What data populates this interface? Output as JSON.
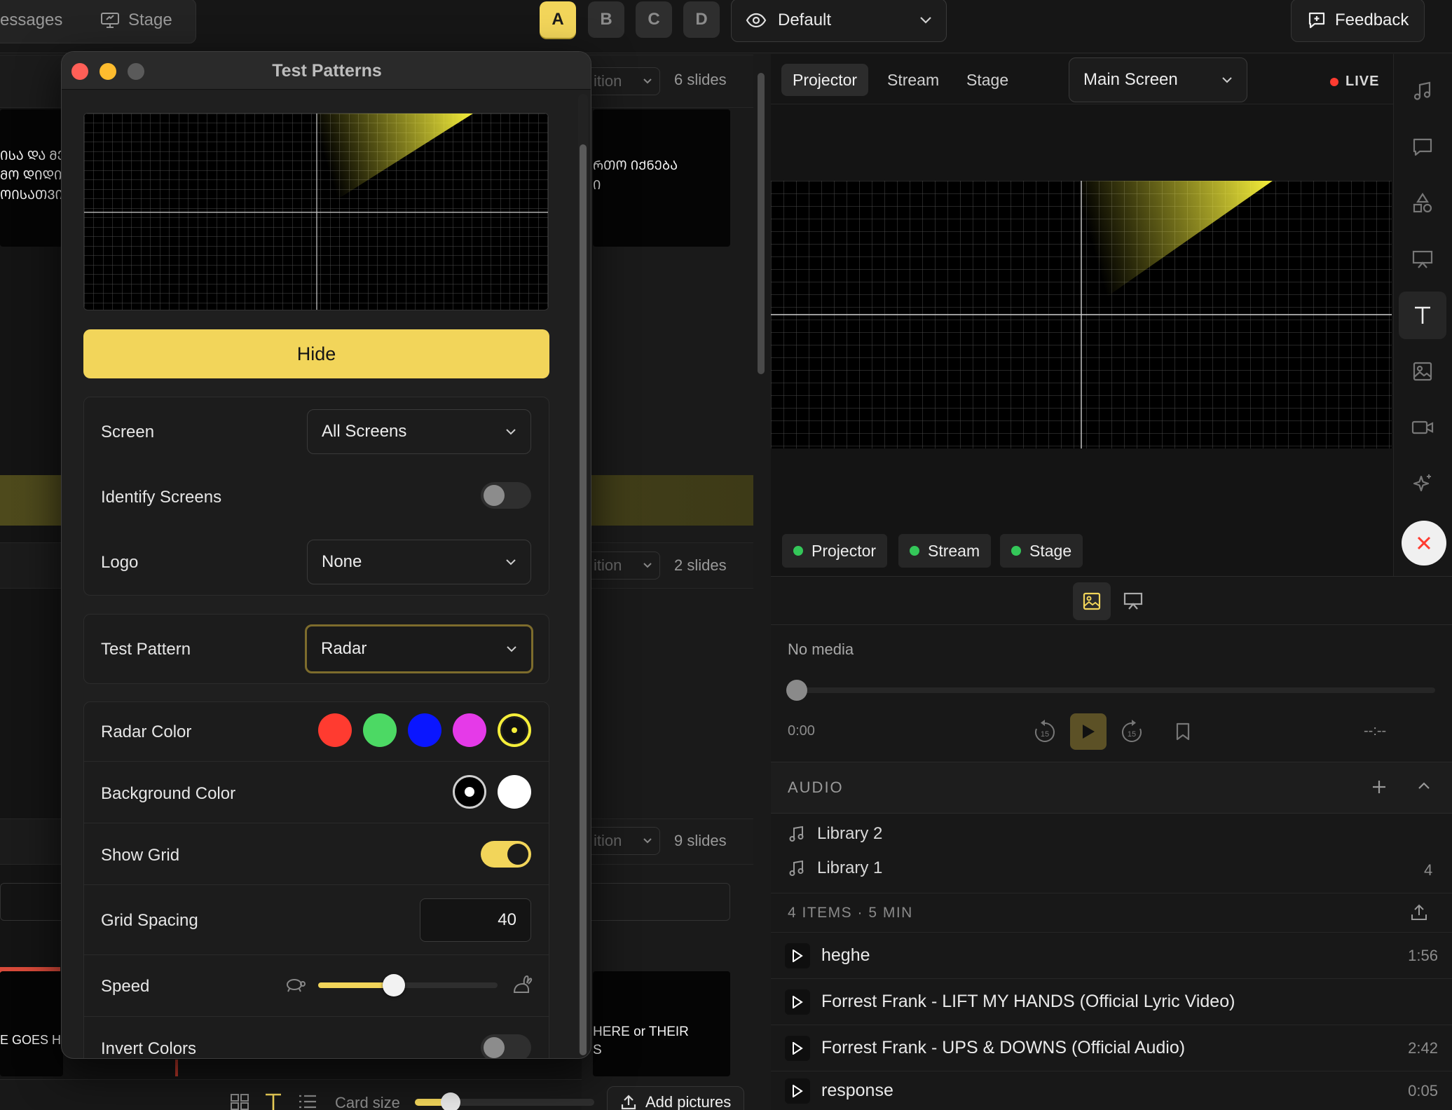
{
  "topbar": {
    "messages_label": "essages",
    "stage_label": "Stage",
    "variants": [
      "A",
      "B",
      "C",
      "D"
    ],
    "look_select": "Default",
    "feedback_label": "Feedback"
  },
  "left_panel": {
    "slides_counts": [
      "6 slides",
      "2 slides",
      "9 slides"
    ],
    "edition_label": "ition",
    "card1_left_lines": [
      "ᲘᲡᲐ ᲓᲐ ᲛᲔ",
      "ᲛᲝ ᲓᲘᲓᲘ",
      "ᲝᲘᲡᲐᲗᲕᲘ"
    ],
    "card1_right_lines": [
      "ᲠᲗᲝ ᲘᲥᲜᲔᲑᲐ",
      "Ი"
    ],
    "card3_left_text": "E GOES H",
    "card3_right_lines": [
      "HERE or THEIR",
      "S"
    ],
    "bottom_bar": {
      "card_size_label": "Card size",
      "card_size_value": 0.2,
      "add_pictures_label": "Add pictures"
    }
  },
  "dialog": {
    "title": "Test Patterns",
    "hide_label": "Hide",
    "screen_label": "Screen",
    "screen_value": "All Screens",
    "identify_label": "Identify Screens",
    "identify_on": false,
    "logo_label": "Logo",
    "logo_value": "None",
    "pattern_label": "Test Pattern",
    "pattern_value": "Radar",
    "radar_color_label": "Radar Color",
    "radar_colors": [
      "#ff3b30",
      "#4cd964",
      "#0a16ff",
      "#e53ae8",
      "#f5ee3a"
    ],
    "radar_selected": 4,
    "bg_color_label": "Background Color",
    "bg_colors": [
      "#000000",
      "#ffffff"
    ],
    "bg_selected": 0,
    "grid_label": "Show Grid",
    "grid_on": true,
    "spacing_label": "Grid Spacing",
    "spacing_value": "40",
    "speed_label": "Speed",
    "speed_value": 0.42,
    "invert_label": "Invert Colors",
    "invert_on": false
  },
  "output": {
    "tabs": [
      "Projector",
      "Stream",
      "Stage"
    ],
    "active_tab": "Projector",
    "screen_select": "Main Screen",
    "live_label": "LIVE",
    "chips": [
      "Projector",
      "Stream",
      "Stage"
    ]
  },
  "media": {
    "no_media": "No media",
    "time_start": "0:00",
    "time_end": "--:--",
    "skip_back": "15",
    "skip_fwd": "15",
    "audio_header": "AUDIO",
    "libraries": [
      {
        "name": "Library 2",
        "count": ""
      },
      {
        "name": "Library 1",
        "count": "4"
      }
    ],
    "summary": "4 ITEMS · 5 MIN",
    "tracks": [
      {
        "title": "heghe",
        "duration": "1:56"
      },
      {
        "title": "Forrest Frank - LIFT MY HANDS (Official Lyric Video)",
        "duration": ""
      },
      {
        "title": "Forrest Frank - UPS & DOWNS (Official Audio)",
        "duration": "2:42"
      },
      {
        "title": "response",
        "duration": "0:05"
      }
    ]
  },
  "colors": {
    "accent": "#f2d55a",
    "live": "#ff3b30",
    "status_green": "#34c759"
  }
}
